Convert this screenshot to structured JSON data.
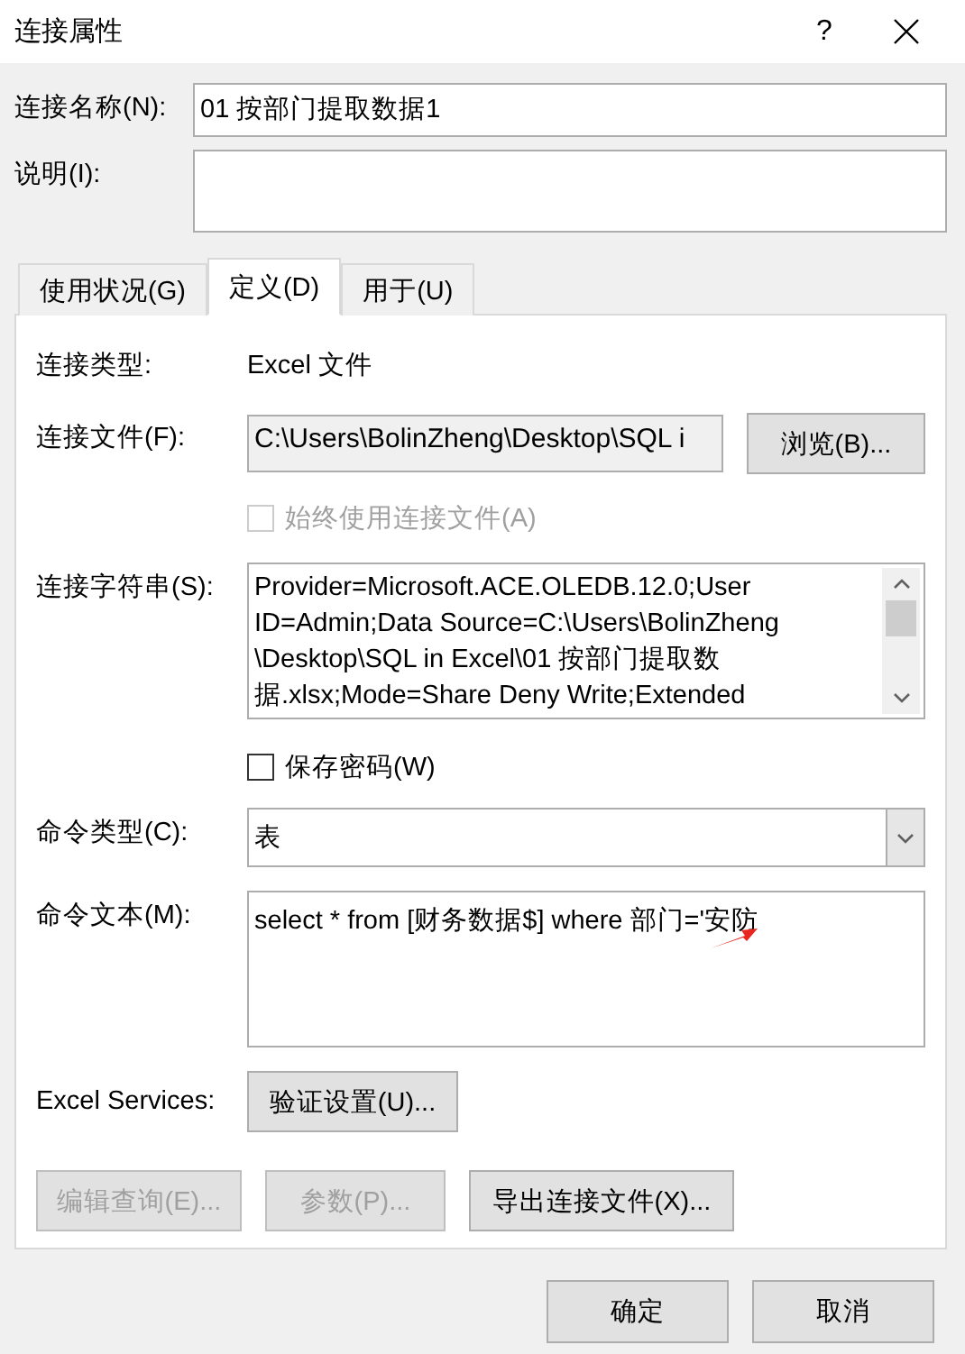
{
  "window": {
    "title": "连接属性",
    "help": "?"
  },
  "name_field": {
    "label": "连接名称(N):",
    "value": "01 按部门提取数据1"
  },
  "description_field": {
    "label": "说明(I):"
  },
  "tabs": [
    {
      "label": "使用状况(G)",
      "selected": false
    },
    {
      "label": "定义(D)",
      "selected": true
    },
    {
      "label": "用于(U)",
      "selected": false
    }
  ],
  "definition": {
    "connection_type": {
      "label": "连接类型:",
      "value": "Excel 文件"
    },
    "connection_file": {
      "label": "连接文件(F):",
      "value": "C:\\Users\\BolinZheng\\Desktop\\SQL i",
      "button": "浏览(B)..."
    },
    "always_use_file": {
      "label": "始终使用连接文件(A)",
      "checked": false,
      "disabled": true
    },
    "connection_string": {
      "label": "连接字符串(S):",
      "lines": [
        "Provider=Microsoft.ACE.OLEDB.12.0;User",
        "ID=Admin;Data Source=C:\\Users\\BolinZheng",
        "\\Desktop\\SQL in Excel\\01 按部门提取数",
        "据.xlsx;Mode=Share Deny Write;Extended"
      ]
    },
    "save_password": {
      "label": "保存密码(W)",
      "checked": false,
      "disabled": false
    },
    "command_type": {
      "label": "命令类型(C):",
      "value": "表"
    },
    "command_text": {
      "label": "命令文本(M):",
      "value": "select * from [财务数据$] where 部门='安防"
    },
    "excel_services": {
      "label": "Excel Services:",
      "button": "验证设置(U)..."
    },
    "actions": [
      {
        "label": "编辑查询(E)...",
        "disabled": true
      },
      {
        "label": "参数(P)...",
        "disabled": true
      },
      {
        "label": "导出连接文件(X)...",
        "disabled": false
      }
    ]
  },
  "footer_buttons": [
    {
      "label": "确定"
    },
    {
      "label": "取消"
    }
  ]
}
